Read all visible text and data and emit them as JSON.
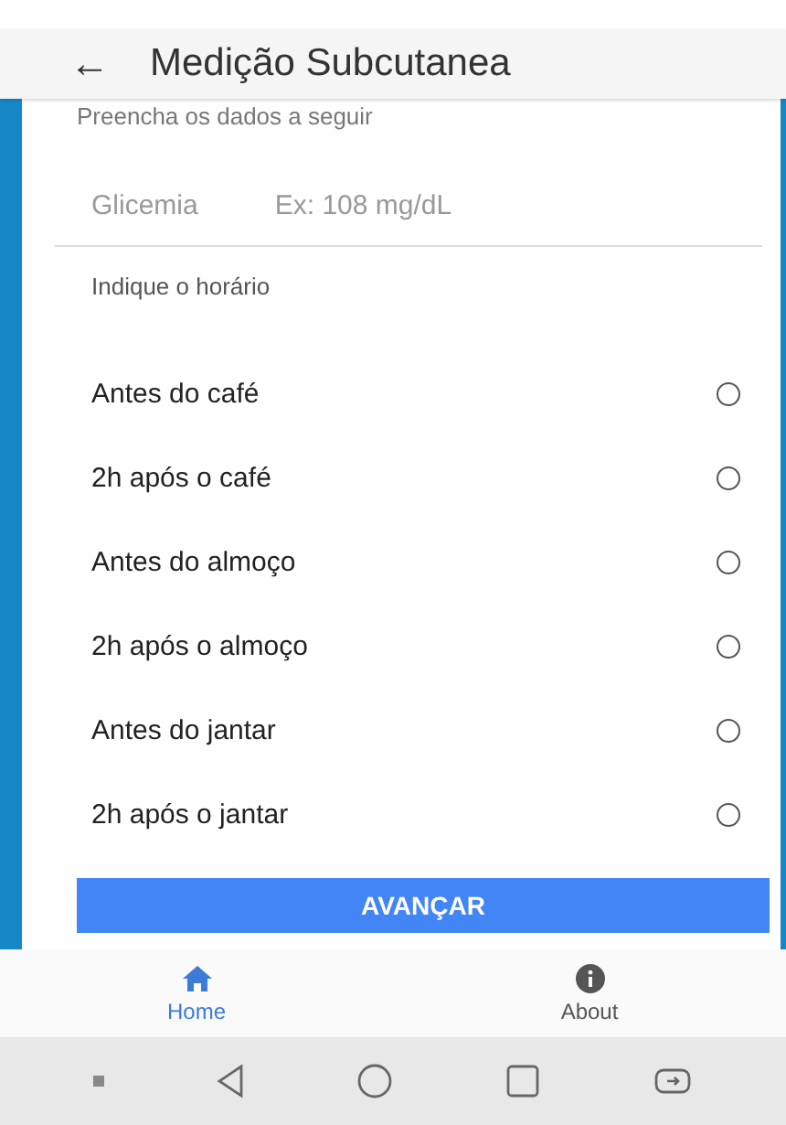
{
  "app_bar": {
    "back_icon": "←",
    "title": "Medição Subcutanea"
  },
  "form": {
    "intro": "Preencha os dados a seguir",
    "glucose": {
      "label": "Glicemia",
      "placeholder": "Ex: 108 mg/dL"
    },
    "time_prompt": "Indique o horário",
    "options": [
      {
        "label": "Antes do café",
        "selected": false
      },
      {
        "label": "2h após o café",
        "selected": false
      },
      {
        "label": "Antes do almoço",
        "selected": false
      },
      {
        "label": "2h após o almoço",
        "selected": false
      },
      {
        "label": "Antes do jantar",
        "selected": false
      },
      {
        "label": "2h após o jantar",
        "selected": false
      }
    ],
    "submit": "AVANÇAR"
  },
  "bottom_nav": [
    {
      "label": "Home",
      "kind": "home",
      "selected": true
    },
    {
      "label": "About",
      "kind": "info",
      "selected": false
    }
  ]
}
